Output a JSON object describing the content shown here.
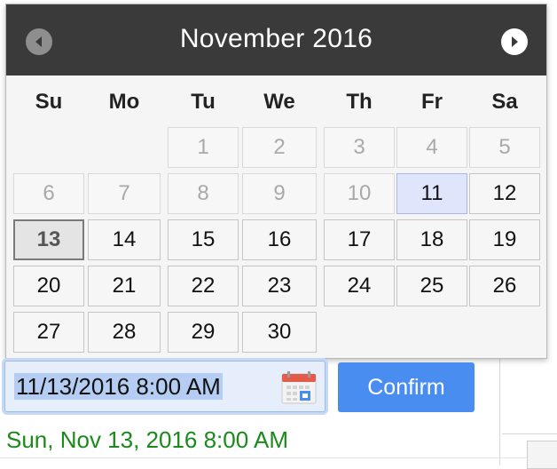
{
  "calendar": {
    "title": "November 2016",
    "days_of_week": [
      "Su",
      "Mo",
      "Tu",
      "We",
      "Th",
      "Fr",
      "Sa"
    ],
    "weeks": [
      [
        null,
        null,
        {
          "d": "1",
          "s": "disabled"
        },
        {
          "d": "2",
          "s": "disabled"
        },
        {
          "d": "3",
          "s": "disabled"
        },
        {
          "d": "4",
          "s": "disabled"
        },
        {
          "d": "5",
          "s": "disabled"
        }
      ],
      [
        {
          "d": "6",
          "s": "disabled"
        },
        {
          "d": "7",
          "s": "disabled"
        },
        {
          "d": "8",
          "s": "disabled"
        },
        {
          "d": "9",
          "s": "disabled"
        },
        {
          "d": "10",
          "s": "disabled"
        },
        {
          "d": "11",
          "s": "today"
        },
        {
          "d": "12",
          "s": "normal"
        }
      ],
      [
        {
          "d": "13",
          "s": "selected"
        },
        {
          "d": "14",
          "s": "normal"
        },
        {
          "d": "15",
          "s": "normal"
        },
        {
          "d": "16",
          "s": "normal"
        },
        {
          "d": "17",
          "s": "normal"
        },
        {
          "d": "18",
          "s": "normal"
        },
        {
          "d": "19",
          "s": "normal"
        }
      ],
      [
        {
          "d": "20",
          "s": "normal"
        },
        {
          "d": "21",
          "s": "normal"
        },
        {
          "d": "22",
          "s": "normal"
        },
        {
          "d": "23",
          "s": "normal"
        },
        {
          "d": "24",
          "s": "normal"
        },
        {
          "d": "25",
          "s": "normal"
        },
        {
          "d": "26",
          "s": "normal"
        }
      ],
      [
        {
          "d": "27",
          "s": "normal"
        },
        {
          "d": "28",
          "s": "normal"
        },
        {
          "d": "29",
          "s": "normal"
        },
        {
          "d": "30",
          "s": "normal"
        },
        null,
        null,
        null
      ]
    ],
    "prev_icon": "chevron-left-icon",
    "next_icon": "chevron-right-icon"
  },
  "datetime_input": {
    "value": "11/13/2016 8:00 AM",
    "icon": "calendar-icon"
  },
  "confirm_button": {
    "label": "Confirm"
  },
  "result": {
    "text": "Sun, Nov 13, 2016 8:00 AM"
  },
  "colors": {
    "header_bg": "#3a3a3a",
    "confirm_bg": "#4a8df0",
    "result_text": "#1b8a1b",
    "today_bg": "#dfe6fb"
  }
}
